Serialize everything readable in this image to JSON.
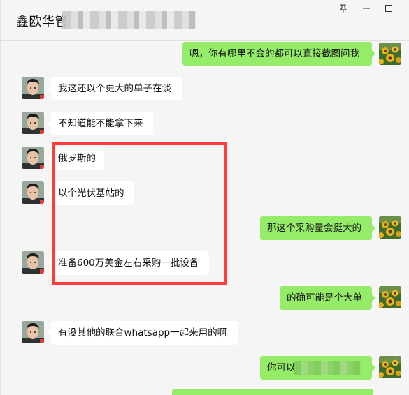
{
  "window": {
    "title": "鑫欧华管",
    "controls": {
      "pin_icon": "pin-icon",
      "minimize_icon": "minimize-icon",
      "maximize_icon": "maximize-icon"
    }
  },
  "colors": {
    "background": "#f5f5f5",
    "incoming_bubble": "#ffffff",
    "outgoing_bubble": "#95ec69",
    "highlight_box": "#ff3b3b"
  },
  "messages": [
    {
      "side": "right",
      "text": "嗯，你有哪里不会的都可以直接截图问我"
    },
    {
      "side": "left",
      "text": "我这还以个更大的单子在谈"
    },
    {
      "side": "left",
      "text": "不知道能不能拿下来"
    },
    {
      "side": "left",
      "text": "俄罗斯的"
    },
    {
      "side": "left",
      "text": "以个光伏基站的"
    },
    {
      "side": "right",
      "text": "那这个采购量会挺大的"
    },
    {
      "side": "left",
      "text": "准备600万美金左右采购一批设备"
    },
    {
      "side": "right",
      "text": "的确可能是个大单"
    },
    {
      "side": "left",
      "text": "有没其他的联合whatsapp一起来用的啊"
    },
    {
      "side": "right",
      "text": "你可以"
    }
  ]
}
